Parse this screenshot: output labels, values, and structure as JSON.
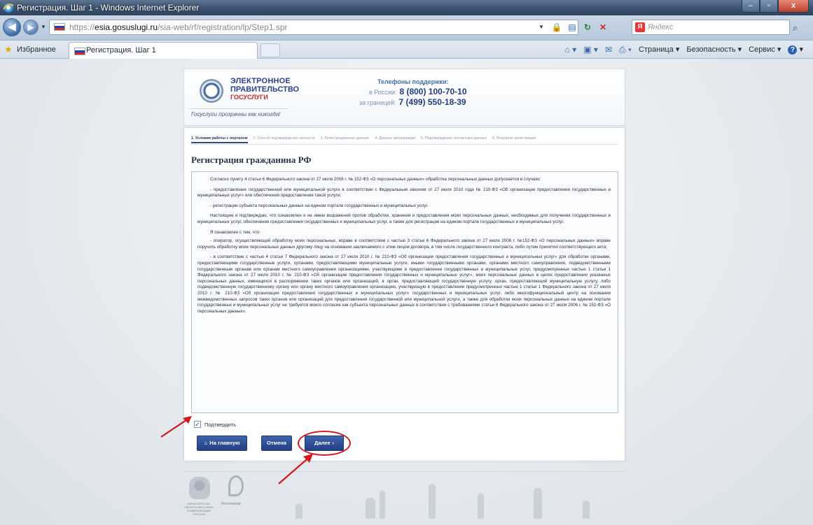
{
  "window": {
    "title": "Регистрация. Шаг 1 - Windows Internet Explorer",
    "buttons": {
      "minimize": "–",
      "maximize": "▫",
      "close": "x"
    }
  },
  "address_bar": {
    "url_prefix": "https://",
    "url_host": "esia.gosuslugi.ru",
    "url_path": "/sia-web/rf/registration/lp/Step1.spr"
  },
  "search": {
    "placeholder": "Яндекс",
    "engine_icon": "Я"
  },
  "favorites": {
    "label": "Избранное"
  },
  "tab": {
    "title": "Регистрация. Шаг 1"
  },
  "command_bar": {
    "page": "Страница ▾",
    "safety": "Безопасность ▾",
    "tools": "Сервис ▾",
    "help": "?"
  },
  "banner": {
    "brand_line1": "ЭЛЕКТРОННОЕ",
    "brand_line2": "ПРАВИТЕЛЬСТВО",
    "brand_line3": "ГОСУСЛУГИ",
    "slogan": "Госуслуги прозрачны как никогда!",
    "support_title": "Телефоны поддержки:",
    "support_russia_label": "в России:",
    "support_russia_phone": "8 (800) 100-70-10",
    "support_abroad_label": "за границей:",
    "support_abroad_phone": "7 (499) 550-18-39"
  },
  "steps": [
    {
      "label": "1. Условия работы с порталом",
      "active": true
    },
    {
      "label": "2. Способ подтверждения личности",
      "active": false
    },
    {
      "label": "3. Регистрационные данные",
      "active": false
    },
    {
      "label": "4. Данные авторизации",
      "active": false
    },
    {
      "label": "5. Подтверждение контактных данных",
      "active": false
    },
    {
      "label": "6. Результат регистрации",
      "active": false
    }
  ],
  "page_heading": "Регистрация гражданина РФ",
  "terms": [
    "Согласно пункту 4 статьи 6 Федерального закона от 27 июля 2006 г. № 152-ФЗ «О персональных данных» обработка персональных данных допускается в случаях:",
    "- предоставления государственной или муниципальной услуги в соответствии с Федеральным законом от 27 июля 2010 года № 210-ФЗ «Об организации предоставления государственных и муниципальных услуг» или обеспечения предоставления такой услуги;",
    "- регистрации субъекта персональных данных на едином портале государственных и муниципальных услуг.",
    "Настоящим я подтверждаю, что ознакомлен и не имею возражений против обработки, хранения и предоставления моих персональных данных, необходимых для получения государственных и муниципальных услуг, обеспечения предоставления государственных и муниципальных услуг, а также для регистрации на едином портале государственных и муниципальных услуг.",
    "Я ознакомлен с тем, что:",
    "- оператор, осуществляющий обработку моих персональных, вправе в соответствии с частью 3 статьи 6 Федерального закона от 27 июля 2006 г. №152-ФЗ «О персональных данных» вправе поручить обработку моих персональных данных другому лицу на основании заключаемого с этим лицом договора, в том числе государственного контракта, либо путем принятия соответствующего акта;",
    "- в соответствии с частью 4 статьи 7 Федерального закона от 27 июля 2010 г. № 210-ФЗ «Об организации предоставления государственных и муниципальных услуг» для обработки органами, предоставляющими государственные услуги, органами, предоставляющими муниципальные услуги, иными государственными органами, органами местного самоуправления, подведомственными государственным органам или органам местного самоуправления организациями, участвующими в предоставлении государственных и муниципальных услуг, предусмотренных частью 1 статьи 1 Федерального закона от 27 июля 2010 г. № 210-ФЗ «Об организации предоставления государственных и муниципальных услуг», моих персональных данных в целях предоставления указанных персональных данных, имеющихся в распоряжении таких органов или организаций, в орган, предоставляющий государственную услугу, орган, предоставляющий муниципальную услугу, либо подведомственную государственному органу или органу местного самоуправления организацию, участвующую в предоставлении предусмотренных частью 1 статьи 1 Федерального закона от 27 июля 2010 г. № 210-ФЗ «Об организации предоставления государственных и муниципальных услуг» государственных и муниципальных услуг, либо многофункциональный центр на основании межведомственных запросов таких органов или организаций для предоставления государственной или муниципальной услуги, а также для обработки моих персональных данных на едином портале государственных и муниципальных услуг не требуется моего согласия как субъекта персональных данных в соответствии с требованиями статьи 6 Федерального закона от 27 июля 2006 г. № 152-ФЗ «О персональных данных»."
  ],
  "confirm": {
    "label": "Подтвердить",
    "checked": true
  },
  "buttons": {
    "home": "На главную",
    "cancel": "Отмена",
    "next": "Далее",
    "next_chevron": "›"
  },
  "footer": {
    "eagle_caption": "МИНИСТЕРСТВО СВЯЗИ И МАССОВЫХ КОММУНИКАЦИЙ РОССИИ",
    "rt_caption": "Ростелеком"
  },
  "annotations": {
    "arrow_color": "#d6171d",
    "ring_color": "#d6171d"
  }
}
